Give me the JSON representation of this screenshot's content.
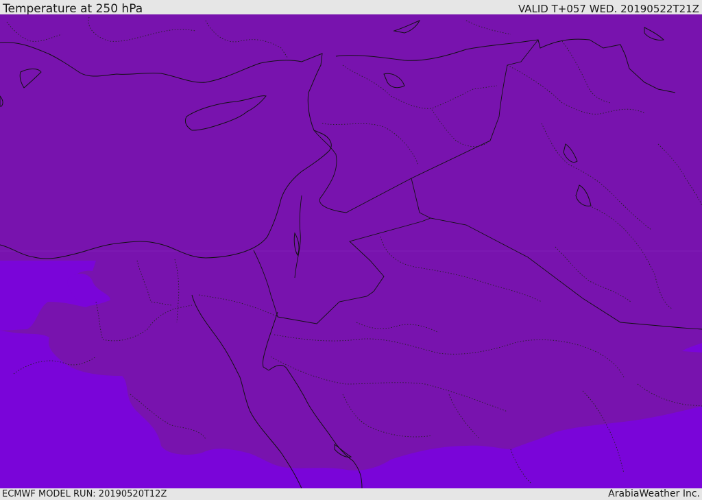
{
  "header": {
    "title": "Temperature at 250 hPa",
    "valid": "VALID T+057 WED. 20190522T21Z"
  },
  "footer": {
    "model_run": "ECMWF MODEL RUN: 20190520T12Z",
    "brand": "ArabiaWeather Inc."
  },
  "colors": {
    "band_cold": "#7813ae",
    "band_warm": "#7a05d9",
    "borders": "#111111",
    "chrome": "#e6e6e6"
  }
}
